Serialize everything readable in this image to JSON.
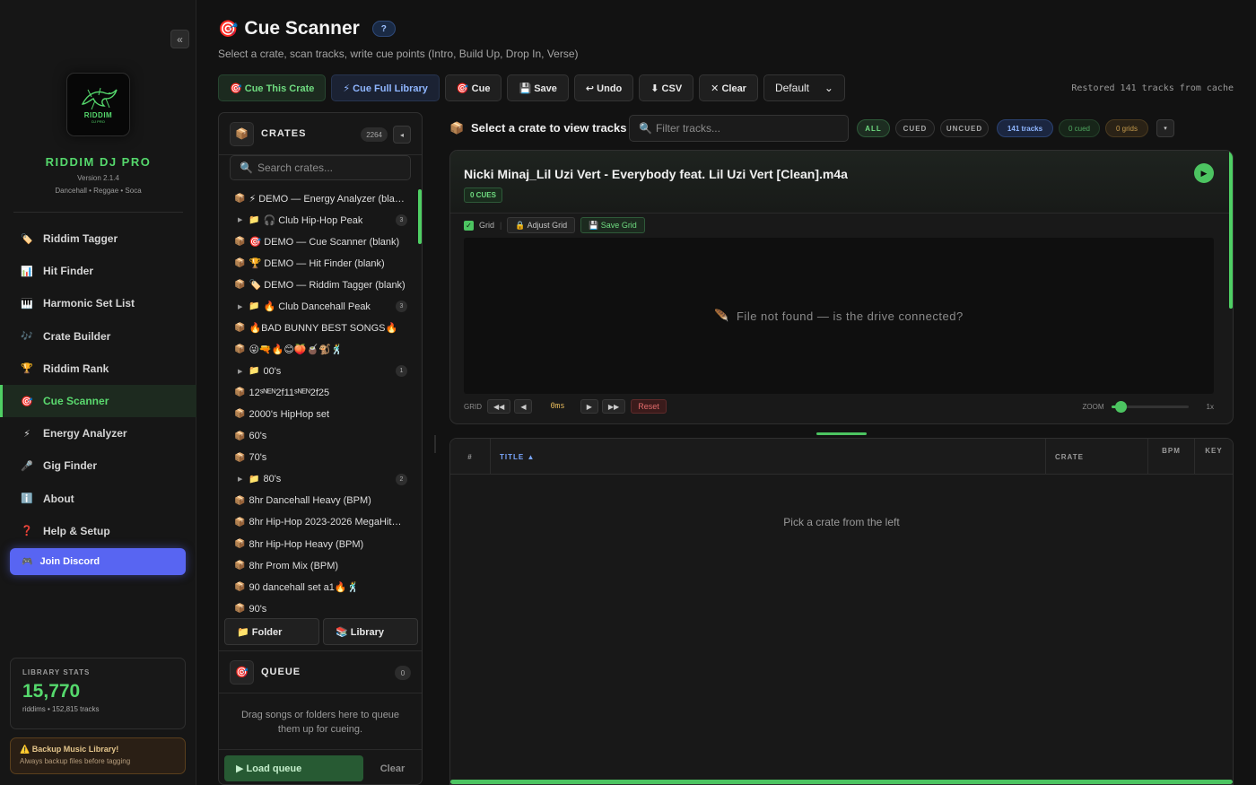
{
  "sidebar": {
    "collapse": "«",
    "logo_text": "RIDDIM",
    "logo_sub": "DJ PRO",
    "brand": "RIDDIM DJ PRO",
    "version": "Version 2.1.4",
    "genres": "Dancehall • Reggae • Soca",
    "nav": [
      {
        "icon": "🏷️",
        "label": "Riddim Tagger"
      },
      {
        "icon": "📊",
        "label": "Hit Finder"
      },
      {
        "icon": "🎹",
        "label": "Harmonic Set List"
      },
      {
        "icon": "🎶",
        "label": "Crate Builder"
      },
      {
        "icon": "🏆",
        "label": "Riddim Rank"
      },
      {
        "icon": "🎯",
        "label": "Cue Scanner",
        "active": true
      },
      {
        "icon": "⚡",
        "label": "Energy Analyzer"
      },
      {
        "icon": "🎤",
        "label": "Gig Finder"
      },
      {
        "icon": "ℹ️",
        "label": "About"
      },
      {
        "icon": "❓",
        "label": "Help & Setup"
      }
    ],
    "discord": {
      "icon": "🎮",
      "label": "Join Discord",
      "color": "#5865f2"
    },
    "stats": {
      "label": "LIBRARY STATS",
      "value": "15,770",
      "sub": "riddims • 152,815 tracks"
    },
    "backup": {
      "title": "⚠️ Backup Music Library!",
      "sub": "Always backup files before tagging"
    }
  },
  "header": {
    "icon": "🎯",
    "title": "Cue Scanner",
    "help": "?",
    "subtitle": "Select a crate, scan tracks, write cue points (Intro, Build Up, Drop In, Verse)"
  },
  "toolbar": {
    "cue_crate": "🎯 Cue This Crate",
    "cue_library": "⚡ Cue Full Library",
    "cue": "🎯 Cue",
    "save": "💾 Save",
    "undo": "↩ Undo",
    "csv": "⬇ CSV",
    "clear": "✕ Clear",
    "preset": "Default",
    "preset_caret": "⌄",
    "status": "Restored 141 tracks from cache"
  },
  "crates": {
    "icon": "📦",
    "title": "CRATES",
    "count": "2264",
    "collapse": "◂",
    "search_icon": "🔍",
    "search_placeholder": "Search crates...",
    "items": [
      {
        "type": "crate",
        "label": "⚡ DEMO — Energy Analyzer (blank)"
      },
      {
        "type": "folder",
        "label": "🎧 Club Hip-Hop Peak",
        "badge": "3"
      },
      {
        "type": "crate",
        "label": "🎯 DEMO — Cue Scanner (blank)"
      },
      {
        "type": "crate",
        "label": "🏆 DEMO — Hit Finder (blank)"
      },
      {
        "type": "crate",
        "label": "🏷️ DEMO — Riddim Tagger (blank)"
      },
      {
        "type": "folder",
        "label": "🔥 Club Dancehall Peak",
        "badge": "3"
      },
      {
        "type": "crate",
        "label": "🔥BAD BUNNY BEST SONGS🔥"
      },
      {
        "type": "crate",
        "label": "😜🔫🔥😊🍑🧉🐒🕺"
      },
      {
        "type": "folder",
        "label": "00's",
        "badge": "1"
      },
      {
        "type": "crate",
        "label": "12ˢᴺᴱᴺ2f11ˢᴺᴱᴺ2f25"
      },
      {
        "type": "crate",
        "label": "2000's HipHop set"
      },
      {
        "type": "crate",
        "label": "60's"
      },
      {
        "type": "crate",
        "label": "70's"
      },
      {
        "type": "folder",
        "label": "80's",
        "badge": "2"
      },
      {
        "type": "crate",
        "label": "8hr Dancehall Heavy (BPM)"
      },
      {
        "type": "crate",
        "label": "8hr Hip-Hop 2023-2026 MegaHits (Mixed)"
      },
      {
        "type": "crate",
        "label": "8hr Hip-Hop Heavy (BPM)"
      },
      {
        "type": "crate",
        "label": "8hr Prom Mix (BPM)"
      },
      {
        "type": "crate",
        "label": "90 dancehall set a1🔥🕺"
      },
      {
        "type": "crate",
        "label": "90's"
      }
    ],
    "folder_btn": "📁 Folder",
    "library_btn": "📚 Library"
  },
  "queue": {
    "icon": "🎯",
    "title": "QUEUE",
    "count": "0",
    "empty": "Drag songs or folders here to queue them up for cueing.",
    "load": "▶ Load queue",
    "clear": "Clear"
  },
  "tracks": {
    "icon": "📦",
    "title": "Select a crate to view tracks",
    "filter_icon": "🔍",
    "filter_placeholder": "Filter tracks...",
    "chip_all": "ALL",
    "chip_cued": "CUED",
    "chip_uncued": "UNCUED",
    "chip_tracks": "141 tracks",
    "chip_cued_count": "0 cued",
    "chip_grids": "0 grids",
    "menu": "▾"
  },
  "player": {
    "title": "Nicki Minaj_Lil Uzi Vert - Everybody feat. Lil Uzi Vert [Clean].m4a",
    "cues": "0 CUES",
    "play": "▶",
    "grid_check": "✓",
    "grid_label": "Grid",
    "adjust": "🔒 Adjust Grid",
    "save_grid": "💾 Save Grid",
    "wave_icon": "🪶",
    "wave_msg": "File not found — is the drive connected?",
    "grid": "GRID",
    "back_big": "◀◀",
    "back": "◀",
    "offset": "0ms",
    "fwd": "▶",
    "fwd_big": "▶▶",
    "reset": "Reset",
    "zoom_label": "ZOOM",
    "zoom_value": "1x",
    "zoom_level": 0.12
  },
  "table": {
    "col_num": "#",
    "col_title": "TITLE ▲",
    "col_crate": "CRATE",
    "col_bpm": "BPM",
    "col_key": "KEY",
    "empty": "Pick a crate from the left"
  }
}
